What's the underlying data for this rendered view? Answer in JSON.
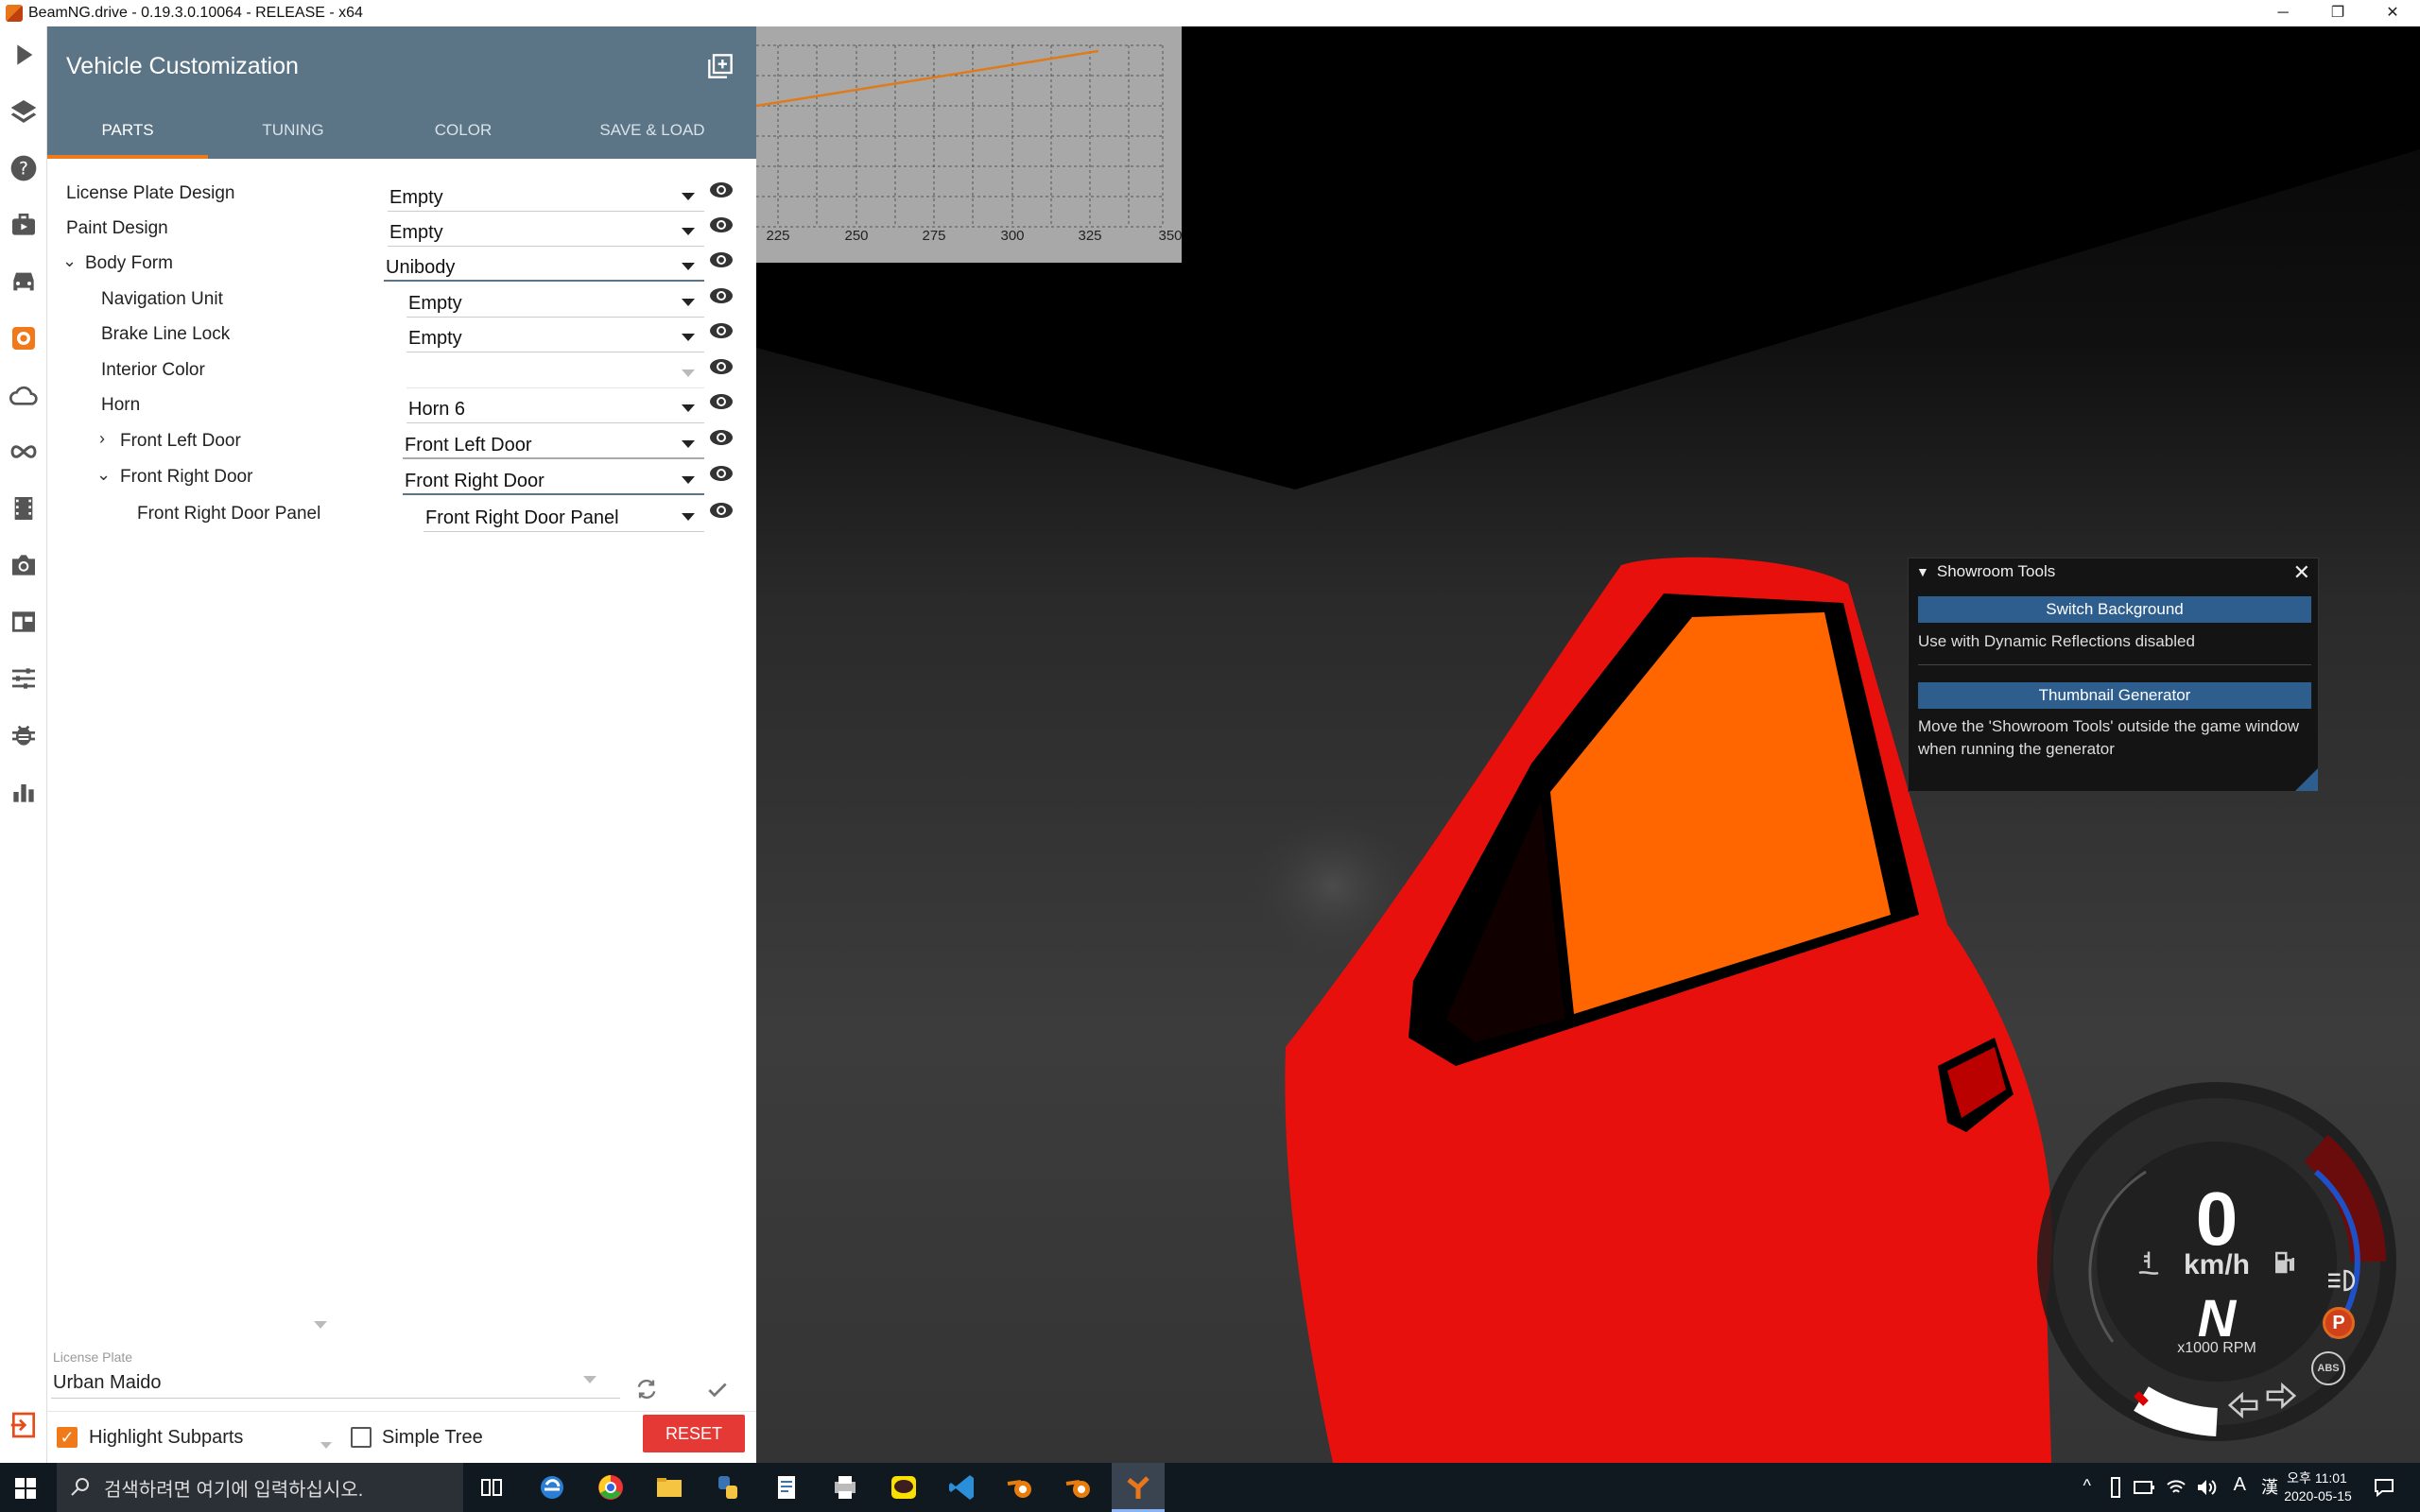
{
  "window": {
    "title": "BeamNG.drive - 0.19.3.0.10064 - RELEASE - x64",
    "controls": [
      "─",
      "❐",
      "✕"
    ]
  },
  "panel": {
    "title": "Vehicle Customization",
    "tabs": [
      {
        "label": "PARTS",
        "active": true
      },
      {
        "label": "TUNING",
        "active": false
      },
      {
        "label": "COLOR",
        "active": false
      },
      {
        "label": "SAVE & LOAD",
        "active": false
      }
    ],
    "parts": [
      {
        "label": "License Plate Design",
        "value": "Empty"
      },
      {
        "label": "Paint Design",
        "value": "Empty"
      },
      {
        "label": "Body Form",
        "value": "Unibody",
        "expanded": true
      },
      {
        "label": "Navigation Unit",
        "value": "Empty"
      },
      {
        "label": "Brake Line Lock",
        "value": "Empty"
      },
      {
        "label": "Interior Color",
        "value": ""
      },
      {
        "label": "Horn",
        "value": "Horn 6"
      },
      {
        "label": "Front Left Door",
        "value": "Front Left Door",
        "expanded": false
      },
      {
        "label": "Front Right Door",
        "value": "Front Right Door",
        "expanded": true
      },
      {
        "label": "Front Right Door Panel",
        "value": "Front Right Door Panel"
      }
    ],
    "license_plate": {
      "label": "License Plate",
      "value": "Urban Maido"
    },
    "bottom": {
      "highlight_subparts": "Highlight Subparts",
      "highlight_checked": true,
      "simple_tree": "Simple Tree",
      "simple_tree_checked": false,
      "reset": "RESET"
    }
  },
  "graph": {
    "x_ticks": [
      "225",
      "250",
      "275",
      "300",
      "325",
      "350"
    ],
    "line_color": "#e07a1a"
  },
  "showroom": {
    "title": "Showroom Tools",
    "switch_bg": "Switch Background",
    "switch_bg_desc": "Use with Dynamic Reflections disabled",
    "thumbnail": "Thumbnail Generator",
    "thumbnail_desc": "Move the 'Showroom Tools' outside the game window when running the generator"
  },
  "gauge": {
    "speed": "0",
    "speed_unit": "km/h",
    "gear": "N",
    "rpm_unit": "x1000 RPM",
    "park": "P",
    "abs": "ABS"
  },
  "taskbar": {
    "search_placeholder": "검색하려면 여기에 입력하십시오.",
    "time": "오후 11:01",
    "date": "2020-05-15",
    "ime": "A",
    "lang": "漢"
  },
  "colors": {
    "panel_header": "#5b7586",
    "accent": "#f07a1a",
    "reset": "#e53935",
    "car": "#e8100c",
    "window_tint": "#ff6600"
  }
}
